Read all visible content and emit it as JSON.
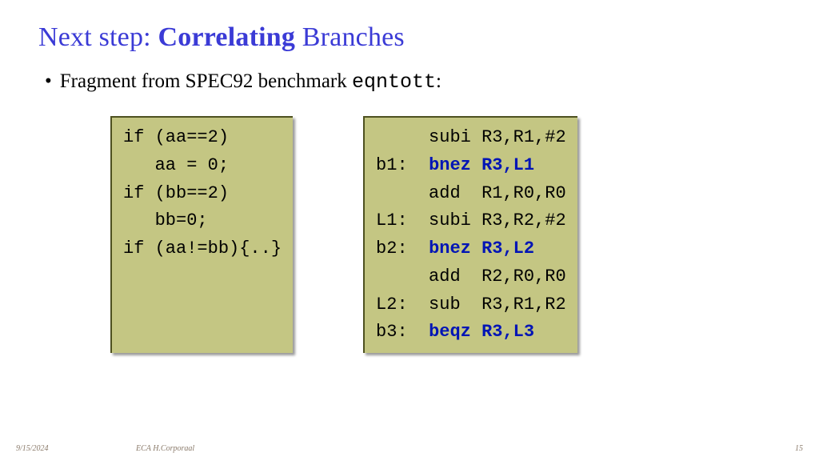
{
  "title": {
    "pre": "Next step: ",
    "bold": "Correlating",
    "post": " Branches"
  },
  "bullet": {
    "text_pre": "Fragment from SPEC92 benchmark ",
    "code": "eqntott",
    "text_post": ":"
  },
  "code_c": {
    "l1": "if (aa==2)",
    "l2": "   aa = 0;",
    "l3": "if (bb==2)",
    "l4": "   bb=0;",
    "l5": "if (aa!=bb){..}"
  },
  "code_asm": {
    "l1": "     subi R3,R1,#2",
    "l2a": "b1:  ",
    "l2b": "bnez R3,L1",
    "l3": "     add  R1,R0,R0",
    "l4": "L1:  subi R3,R2,#2",
    "l5a": "b2:  ",
    "l5b": "bnez R3,L2",
    "l6": "     add  R2,R0,R0",
    "l7": "L2:  sub  R3,R1,R2",
    "l8a": "b3:  ",
    "l8b": "beqz R3,L3"
  },
  "footer": {
    "date": "9/15/2024",
    "author": "ECA  H.Corporaal",
    "page": "15"
  }
}
